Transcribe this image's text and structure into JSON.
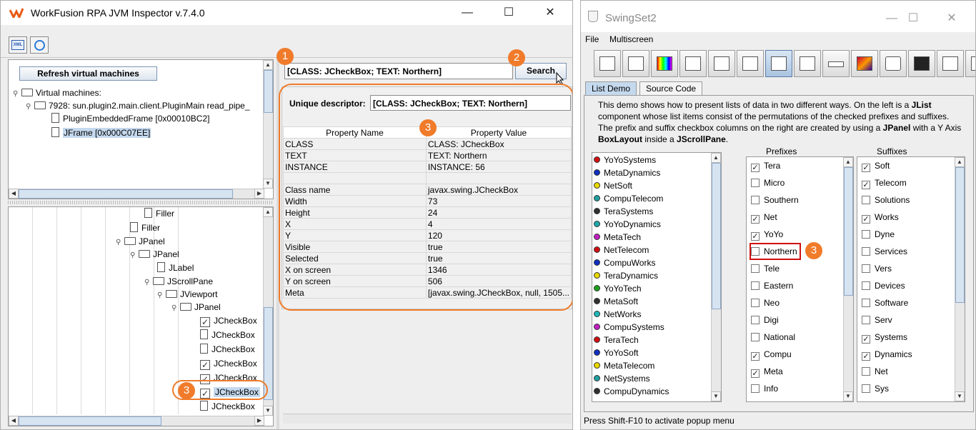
{
  "inspector": {
    "title": "WorkFusion RPA JVM Inspector v.7.4.0",
    "window_controls": {
      "minimize": "—",
      "maximize": "☐",
      "close": "✕"
    },
    "toolbar": {
      "xml_icon_label": "XML"
    },
    "refresh_label": "Refresh virtual machines",
    "vm_tree": [
      {
        "label": "Virtual machines:"
      },
      {
        "label": "7928: sun.plugin2.main.client.PluginMain read_pipe_"
      },
      {
        "label": "PluginEmbeddedFrame [0x00010BC2]"
      },
      {
        "label": "JFrame [0x000C07EE]"
      }
    ],
    "component_tree": [
      {
        "label": "Filler",
        "icon": "file"
      },
      {
        "label": "Filler",
        "icon": "file"
      },
      {
        "label": "JPanel",
        "icon": "folder"
      },
      {
        "label": "JPanel",
        "icon": "folder"
      },
      {
        "label": "JLabel",
        "icon": "file"
      },
      {
        "label": "JScrollPane",
        "icon": "folder"
      },
      {
        "label": "JViewport",
        "icon": "folder"
      },
      {
        "label": "JPanel",
        "icon": "folder"
      },
      {
        "label": "JCheckBox",
        "icon": "check"
      },
      {
        "label": "JCheckBox",
        "icon": "file"
      },
      {
        "label": "JCheckBox",
        "icon": "file"
      },
      {
        "label": "JCheckBox",
        "icon": "check"
      },
      {
        "label": "JCheckBox",
        "icon": "check"
      },
      {
        "label": "JCheckBox",
        "icon": "check"
      },
      {
        "label": "JCheckBox",
        "icon": "file"
      }
    ],
    "search_value": "[CLASS: JCheckBox; TEXT: Northern]",
    "search_button": "Search",
    "unique_descriptor_label": "Unique descriptor:",
    "unique_descriptor_value": "[CLASS: JCheckBox; TEXT: Northern]",
    "table_headers": [
      "Property Name",
      "Property Value"
    ],
    "properties": [
      {
        "name": "CLASS",
        "value": "CLASS: JCheckBox"
      },
      {
        "name": "TEXT",
        "value": "TEXT: Northern"
      },
      {
        "name": "INSTANCE",
        "value": "INSTANCE: 56"
      },
      {
        "name": "",
        "value": ""
      },
      {
        "name": "Class name",
        "value": "javax.swing.JCheckBox"
      },
      {
        "name": "Width",
        "value": "73"
      },
      {
        "name": "Height",
        "value": "24"
      },
      {
        "name": "X",
        "value": "4"
      },
      {
        "name": "Y",
        "value": "120"
      },
      {
        "name": "Visible",
        "value": "true"
      },
      {
        "name": "Selected",
        "value": "true"
      },
      {
        "name": "X on screen",
        "value": "1346"
      },
      {
        "name": "Y on screen",
        "value": "506"
      },
      {
        "name": "Meta",
        "value": "[javax.swing.JCheckBox, null, 1505..."
      }
    ],
    "badges": [
      "1",
      "2",
      "3",
      "3"
    ]
  },
  "swingset": {
    "title": "SwingSet2",
    "window_controls": {
      "minimize": "—",
      "maximize": "☐",
      "close": "✕"
    },
    "menu": [
      "File",
      "Multiscreen"
    ],
    "tabs": [
      "List Demo",
      "Source Code"
    ],
    "description_parts": [
      {
        "t": "This demo shows how to present lists of data in two different ways. On the left is a ",
        "b": false
      },
      {
        "t": "JList",
        "b": true
      },
      {
        "t": " component whose list items consist of the permutations of the checked prefixes and suffixes. The prefix and suffix checkbox columns on the right are created by using a ",
        "b": false
      },
      {
        "t": "JPanel",
        "b": true
      },
      {
        "t": " with a Y Axis ",
        "b": false
      },
      {
        "t": "BoxLayout",
        "b": true
      },
      {
        "t": " inside a ",
        "b": false
      },
      {
        "t": "JScrollPane",
        "b": true
      },
      {
        "t": ".",
        "b": false
      }
    ],
    "list_items": [
      {
        "label": "YoYoSystems",
        "color": "#d01010"
      },
      {
        "label": "MetaDynamics",
        "color": "#1030c0"
      },
      {
        "label": "NetSoft",
        "color": "#e8d800"
      },
      {
        "label": "CompuTelecom",
        "color": "#20a0a0"
      },
      {
        "label": "TeraSystems",
        "color": "#303030"
      },
      {
        "label": "YoYoDynamics",
        "color": "#20a8a8"
      },
      {
        "label": "MetaTech",
        "color": "#c020c0"
      },
      {
        "label": "NetTelecom",
        "color": "#d01010"
      },
      {
        "label": "CompuWorks",
        "color": "#1030c0"
      },
      {
        "label": "TeraDynamics",
        "color": "#e8d800"
      },
      {
        "label": "YoYoTech",
        "color": "#20a020"
      },
      {
        "label": "MetaSoft",
        "color": "#303030"
      },
      {
        "label": "NetWorks",
        "color": "#20b8b8"
      },
      {
        "label": "CompuSystems",
        "color": "#c020c0"
      },
      {
        "label": "TeraTech",
        "color": "#d01010"
      },
      {
        "label": "YoYoSoft",
        "color": "#1030c0"
      },
      {
        "label": "MetaTelecom",
        "color": "#e8d800"
      },
      {
        "label": "NetSystems",
        "color": "#20a0a0"
      },
      {
        "label": "CompuDynamics",
        "color": "#303030"
      }
    ],
    "prefixes_label": "Prefixes",
    "suffixes_label": "Suffixes",
    "prefixes": [
      {
        "label": "Tera",
        "checked": true
      },
      {
        "label": "Micro",
        "checked": false
      },
      {
        "label": "Southern",
        "checked": false
      },
      {
        "label": "Net",
        "checked": true
      },
      {
        "label": "YoYo",
        "checked": true
      },
      {
        "label": "Northern",
        "checked": false
      },
      {
        "label": "Tele",
        "checked": false
      },
      {
        "label": "Eastern",
        "checked": false
      },
      {
        "label": "Neo",
        "checked": false
      },
      {
        "label": "Digi",
        "checked": false
      },
      {
        "label": "National",
        "checked": false
      },
      {
        "label": "Compu",
        "checked": true
      },
      {
        "label": "Meta",
        "checked": true
      },
      {
        "label": "Info",
        "checked": false
      }
    ],
    "suffixes": [
      {
        "label": "Soft",
        "checked": true
      },
      {
        "label": "Telecom",
        "checked": true
      },
      {
        "label": "Solutions",
        "checked": false
      },
      {
        "label": "Works",
        "checked": true
      },
      {
        "label": "Dyne",
        "checked": false
      },
      {
        "label": "Services",
        "checked": false
      },
      {
        "label": "Vers",
        "checked": false
      },
      {
        "label": "Devices",
        "checked": false
      },
      {
        "label": "Software",
        "checked": false
      },
      {
        "label": "Serv",
        "checked": false
      },
      {
        "label": "Systems",
        "checked": true
      },
      {
        "label": "Dynamics",
        "checked": true
      },
      {
        "label": "Net",
        "checked": false
      },
      {
        "label": "Sys",
        "checked": false
      }
    ],
    "status": "Press Shift-F10 to activate popup menu"
  },
  "colors": {
    "accent": "#f07b2a",
    "highlight": "#c5d9ee",
    "red_box": "#d01010"
  }
}
